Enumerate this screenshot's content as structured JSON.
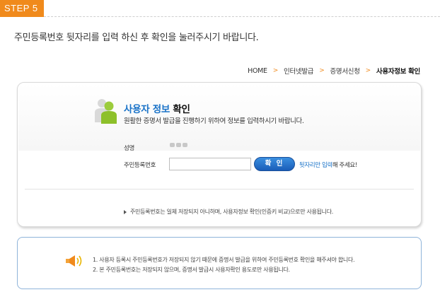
{
  "step": {
    "label": "STEP 5"
  },
  "instruction": "주민등록번호 뒷자리를 입력 하신 후 확인을 눌러주시기 바랍니다.",
  "breadcrumb": {
    "items": [
      "HOME",
      "인터넷발급",
      "증명서신청"
    ],
    "current": "사용자정보 확인",
    "separator": ">"
  },
  "panel": {
    "title_prefix": "사용자 정보",
    "title_strong": "확인",
    "subtitle": "원활한 증명서 발급을 진행하기 위하여 정보를 입력하시기 바랍니다.",
    "name_label": "성명",
    "ssn_label": "주민등록번호",
    "ssn_value": "",
    "ssn_placeholder": "",
    "confirm_label": "확 인",
    "hint_blue": "뒷자리만 입력",
    "hint_rest": "해 주세요!",
    "notice": "주민등록번호는 일체 저장되지 아니하며, 사용자정보 확인(인증키 비교)으로만 사용됩니다."
  },
  "notice_box": {
    "line1": "1. 사용자 등록시 주민등록번호가 저장되지 않기 때문에 증명서 발급을 위하여 주민등록번호 확인을 해주셔야 합니다.",
    "line2": "2. 본 주민등록번호는 저장되지 않으며, 증명서 발급시 사용자확인 용도로만 사용됩니다."
  },
  "colors": {
    "accent_orange": "#f08a1c",
    "title_blue": "#1a73c8",
    "button_blue": "#1a5db8"
  },
  "icons": {
    "user": "user-profile-icon",
    "speaker": "megaphone-icon"
  }
}
